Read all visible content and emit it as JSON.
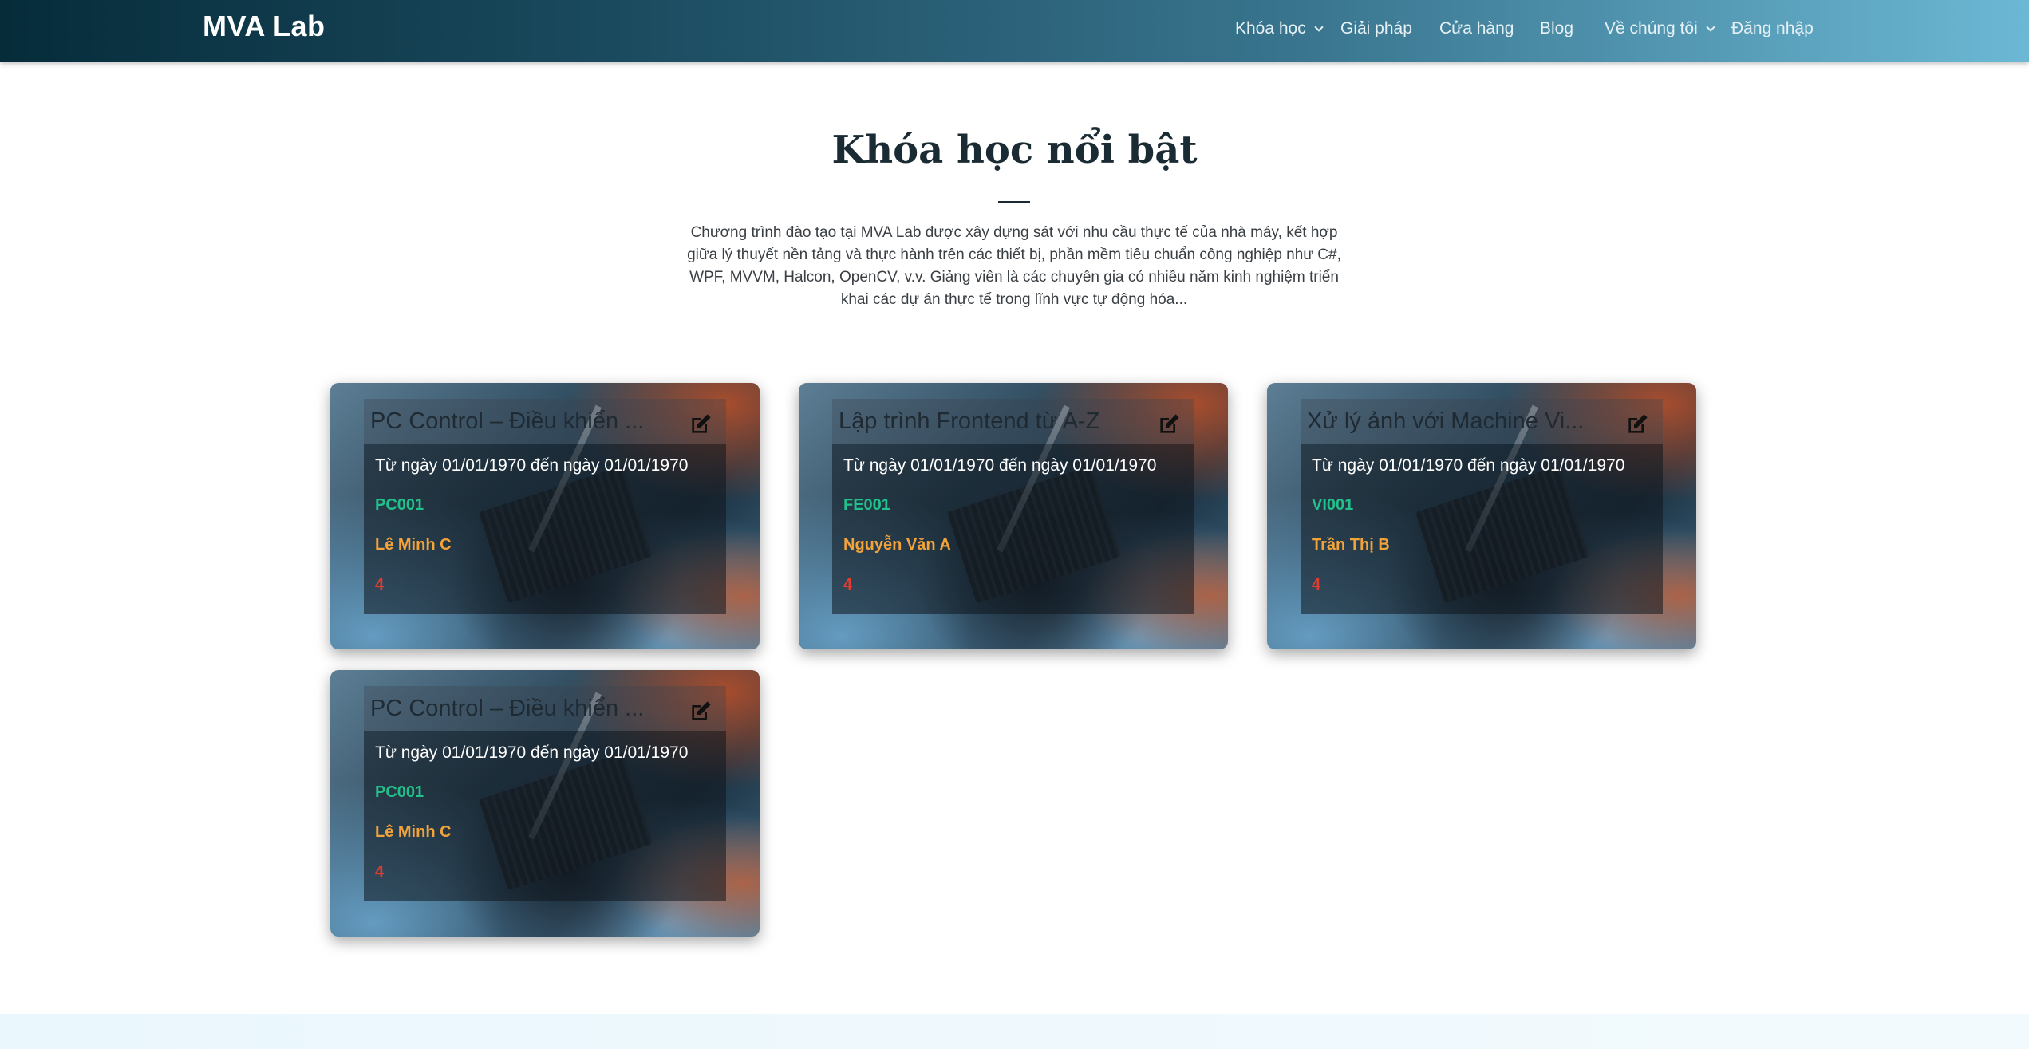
{
  "brand": "MVA Lab",
  "nav": {
    "items": [
      {
        "label": "Khóa học",
        "dropdown": true
      },
      {
        "label": "Giải pháp",
        "dropdown": false
      },
      {
        "label": "Cửa hàng",
        "dropdown": false
      },
      {
        "label": "Blog",
        "dropdown": false
      },
      {
        "label": "Về chúng tôi",
        "dropdown": true
      },
      {
        "label": "Đăng nhập",
        "dropdown": false
      }
    ]
  },
  "section": {
    "title": "Khóa học nổi bật",
    "description": "Chương trình đào tạo tại MVA Lab được xây dựng sát với nhu cầu thực tế của nhà máy, kết hợp giữa lý thuyết nền tảng và thực hành trên các thiết bị, phần mềm tiêu chuẩn công nghiệp như C#, WPF, MVVM, Halcon, OpenCV, v.v. Giảng viên là các chuyên gia có nhiều năm kinh nghiệm triển khai các dự án thực tế trong lĩnh vực tự động hóa..."
  },
  "courses": [
    {
      "title": "PC Control – Điều khiển ...",
      "dates": "Từ ngày 01/01/1970 đến ngày 01/01/1970",
      "code": "PC001",
      "teacher": "Lê Minh C",
      "count": "4",
      "icon": "edit-icon"
    },
    {
      "title": "Lập trình Frontend từ A-Z",
      "dates": "Từ ngày 01/01/1970 đến ngày 01/01/1970",
      "code": "FE001",
      "teacher": "Nguyễn Văn A",
      "count": "4",
      "icon": "edit-icon"
    },
    {
      "title": "Xử lý ảnh với Machine Vi...",
      "dates": "Từ ngày 01/01/1970 đến ngày 01/01/1970",
      "code": "VI001",
      "teacher": "Trần Thị B",
      "count": "4",
      "icon": "edit-icon"
    },
    {
      "title": "PC Control – Điều khiển ...",
      "dates": "Từ ngày 01/01/1970 đến ngày 01/01/1970",
      "code": "PC001",
      "teacher": "Lê Minh C",
      "count": "4",
      "icon": "edit-icon"
    }
  ],
  "colors": {
    "code": "#22c08b",
    "teacher": "#f2a33a",
    "count": "#e53b2f",
    "title": "#1b2b33"
  }
}
